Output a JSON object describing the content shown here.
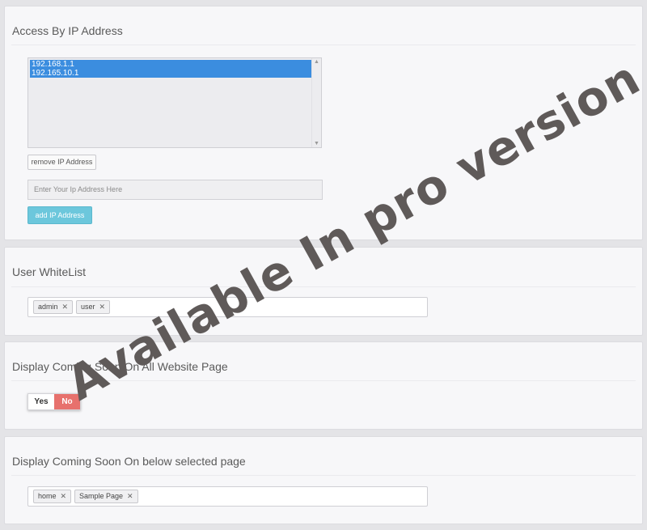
{
  "access_ip": {
    "title": "Access By IP Address",
    "ip_list": [
      "192.168.1.1",
      "192.165.10.1"
    ],
    "remove_label": "remove IP Address",
    "input_placeholder": "Enter Your Ip Address Here",
    "add_label": "add IP Address"
  },
  "user_whitelist": {
    "title": "User WhiteList",
    "tags": [
      "admin",
      "user"
    ]
  },
  "display_all": {
    "title": "Display Coming Soon On All Website Page",
    "yes_label": "Yes",
    "no_label": "No",
    "selected": "No"
  },
  "display_selected": {
    "title": "Display Coming Soon On below selected page",
    "tags": [
      "home",
      "Sample Page"
    ]
  },
  "watermark": "Available In pro version",
  "colors": {
    "selected_item": "#3b8ddf",
    "add_button": "#6cc7dc",
    "toggle_no": "#e7716d",
    "watermark": "#5f5a59"
  },
  "icons": {
    "scroll_up": "chevron-up-icon",
    "scroll_down": "chevron-down-icon",
    "tag_remove": "close-icon"
  }
}
